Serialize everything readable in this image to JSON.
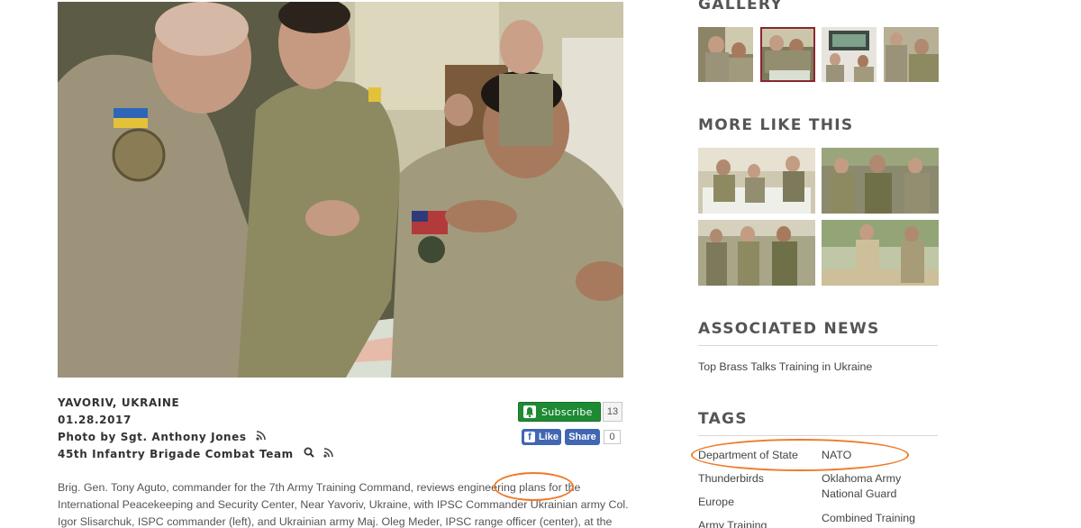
{
  "meta": {
    "location": "YAVORIV, UKRAINE",
    "date": "01.28.2017",
    "photo_by": "Photo by Sgt. Anthony Jones",
    "unit": "45th Infantry Brigade Combat Team"
  },
  "social": {
    "subscribe_label": "Subscribe",
    "subscribe_count": "13",
    "like_label": "Like",
    "share_label": "Share",
    "like_count": "0"
  },
  "caption": {
    "line1": "Brig. Gen. Tony Aguto, commander for the 7th Army Training Command, reviews engineering plans for the",
    "line2": "International Peacekeeping and Security Center, Near Yavoriv, Ukraine, with IPSC Commander Ukrainian army Col.",
    "line3": "Igor Slisarchuk, ISPC commander (left), and Ukrainian army Maj. Oleg Meder, IPSC range officer (center), at the IPSC"
  },
  "sidebar": {
    "gallery_title": "GALLERY",
    "more_title": "MORE LIKE THIS",
    "news_title": "ASSOCIATED NEWS",
    "news_items": [
      "Top Brass Talks Training in Ukraine"
    ],
    "tags_title": "TAGS",
    "tags": [
      "Department of State",
      "NATO",
      "Thunderbirds",
      "Oklahoma Army National Guard",
      "Europe",
      "Combined Training",
      "Army Training"
    ]
  },
  "colors": {
    "subscribe_green": "#1f8a34",
    "facebook_blue": "#4267b2",
    "annotation_orange": "#ee7b2b",
    "active_thumb_border": "#8a2630"
  },
  "icons": [
    "rss-icon",
    "search-icon",
    "bell-icon",
    "facebook-icon"
  ]
}
